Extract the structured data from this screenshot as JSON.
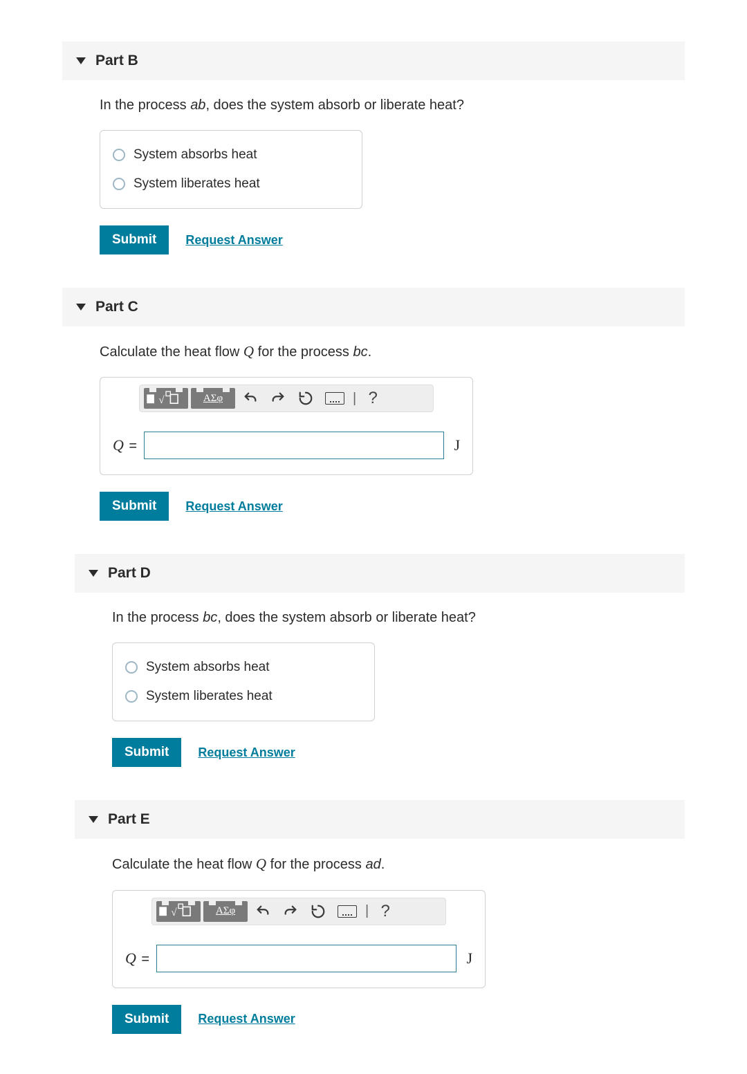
{
  "buttons": {
    "submit": "Submit",
    "request_answer": "Request Answer"
  },
  "toolbar": {
    "templates": "",
    "greek": "ΑΣφ"
  },
  "units": {
    "joule": "J"
  },
  "vars": {
    "Q": "Q",
    "equals": "="
  },
  "partB": {
    "title": "Part B",
    "prompt_pre": "In the process ",
    "prompt_ital": "ab",
    "prompt_post": ", does the system absorb or liberate heat?",
    "options": [
      "System absorbs heat",
      "System liberates heat"
    ]
  },
  "partC": {
    "title": "Part C",
    "prompt_pre": "Calculate the heat flow ",
    "prompt_var": "Q",
    "prompt_mid": " for the process ",
    "prompt_ital": "bc",
    "prompt_post": "."
  },
  "partD": {
    "title": "Part D",
    "prompt_pre": "In the process ",
    "prompt_ital": "bc",
    "prompt_post": ", does the system absorb or liberate heat?",
    "options": [
      "System absorbs heat",
      "System liberates heat"
    ]
  },
  "partE": {
    "title": "Part E",
    "prompt_pre": "Calculate the heat flow ",
    "prompt_var": "Q",
    "prompt_mid": " for the process ",
    "prompt_ital": "ad",
    "prompt_post": "."
  }
}
